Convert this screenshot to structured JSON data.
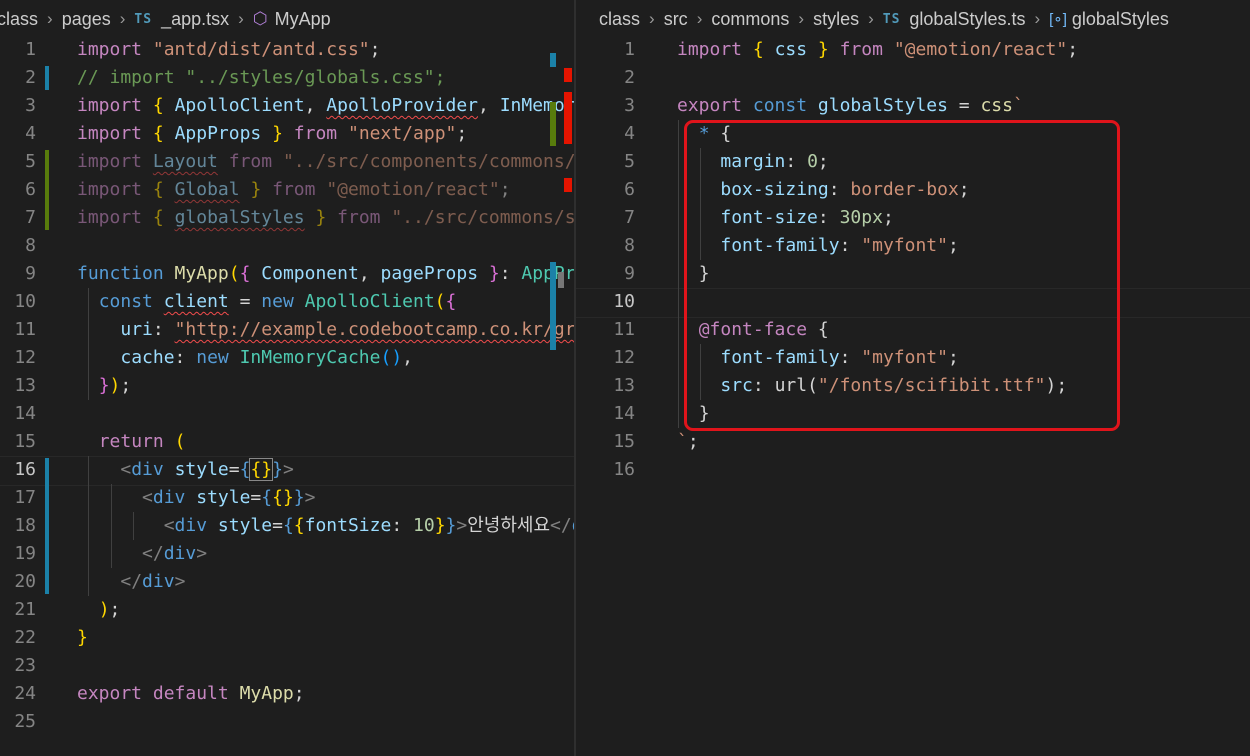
{
  "left": {
    "breadcrumb": [
      "class",
      "pages",
      "_app.tsx",
      "MyApp"
    ],
    "breadcrumb_icons": [
      "typescript-file-icon",
      "symbol-method-icon"
    ],
    "active_line": 16,
    "lines": [
      {
        "n": "1",
        "parts": [
          [
            "import",
            "k"
          ],
          [
            " ",
            "w"
          ],
          [
            "\"antd/dist/antd.css\"",
            "s"
          ],
          [
            ";",
            "w"
          ]
        ]
      },
      {
        "n": "2",
        "parts": [
          [
            "// import \"../styles/globals.css\";",
            "c"
          ]
        ]
      },
      {
        "n": "3",
        "parts": [
          [
            "import",
            "k"
          ],
          [
            " ",
            "w"
          ],
          [
            "{",
            "b1"
          ],
          [
            " ",
            "w"
          ],
          [
            "ApolloClient",
            "v"
          ],
          [
            ", ",
            "w"
          ],
          [
            "ApolloProvider",
            "v sq"
          ],
          [
            ", ",
            "w"
          ],
          [
            "InMemoryCache",
            "v"
          ]
        ]
      },
      {
        "n": "4",
        "parts": [
          [
            "import",
            "k"
          ],
          [
            " ",
            "w"
          ],
          [
            "{",
            "b1"
          ],
          [
            " ",
            "w"
          ],
          [
            "AppProps",
            "v"
          ],
          [
            " ",
            "w"
          ],
          [
            "}",
            "b1"
          ],
          [
            " ",
            "w"
          ],
          [
            "from",
            "k"
          ],
          [
            " ",
            "w"
          ],
          [
            "\"next/app\"",
            "s"
          ],
          [
            ";",
            "w"
          ]
        ]
      },
      {
        "n": "5",
        "parts": [
          [
            "import",
            "k dim"
          ],
          [
            " ",
            "w"
          ],
          [
            "Layout",
            "v sq dim"
          ],
          [
            " ",
            "w"
          ],
          [
            "from",
            "k dim"
          ],
          [
            " ",
            "w"
          ],
          [
            "\"../src/components/commons/layout\"",
            "s dim"
          ]
        ]
      },
      {
        "n": "6",
        "parts": [
          [
            "import",
            "k dim"
          ],
          [
            " ",
            "w"
          ],
          [
            "{",
            "b1 dim"
          ],
          [
            " ",
            "w"
          ],
          [
            "Global",
            "v sq dim"
          ],
          [
            " ",
            "w"
          ],
          [
            "}",
            "b1 dim"
          ],
          [
            " ",
            "w"
          ],
          [
            "from",
            "k dim"
          ],
          [
            " ",
            "w"
          ],
          [
            "\"@emotion/react\"",
            "s dim"
          ],
          [
            ";",
            "w dim"
          ]
        ]
      },
      {
        "n": "7",
        "parts": [
          [
            "import",
            "k dim"
          ],
          [
            " ",
            "w"
          ],
          [
            "{",
            "b1 dim"
          ],
          [
            " ",
            "w"
          ],
          [
            "globalStyles",
            "v sq dim"
          ],
          [
            " ",
            "w"
          ],
          [
            "}",
            "b1 dim"
          ],
          [
            " ",
            "w"
          ],
          [
            "from",
            "k dim"
          ],
          [
            " ",
            "w"
          ],
          [
            "\"../src/commons/styles\"",
            "s dim"
          ]
        ]
      },
      {
        "n": "8",
        "parts": []
      },
      {
        "n": "9",
        "parts": [
          [
            "function",
            "kw"
          ],
          [
            " ",
            "w"
          ],
          [
            "MyApp",
            "f"
          ],
          [
            "(",
            "b1"
          ],
          [
            "{",
            "b2"
          ],
          [
            " ",
            "w"
          ],
          [
            "Component",
            "v"
          ],
          [
            ", ",
            "w"
          ],
          [
            "pageProps",
            "v"
          ],
          [
            " ",
            "w"
          ],
          [
            "}",
            "b2"
          ],
          [
            ": ",
            "w"
          ],
          [
            "AppProps",
            "t"
          ],
          [
            ")",
            "b1"
          ]
        ]
      },
      {
        "n": "10",
        "parts": [
          [
            "  ",
            "w"
          ],
          [
            "const",
            "kw"
          ],
          [
            " ",
            "w"
          ],
          [
            "client",
            "v sq"
          ],
          [
            " = ",
            "w"
          ],
          [
            "new",
            "kw"
          ],
          [
            " ",
            "w"
          ],
          [
            "ApolloClient",
            "t"
          ],
          [
            "(",
            "b1"
          ],
          [
            "{",
            "b2"
          ]
        ]
      },
      {
        "n": "11",
        "parts": [
          [
            "    ",
            "w"
          ],
          [
            "uri",
            "v"
          ],
          [
            ": ",
            "w"
          ],
          [
            "\"http://example.codebootcamp.co.kr/graphql\"",
            "s sq"
          ]
        ]
      },
      {
        "n": "12",
        "parts": [
          [
            "    ",
            "w"
          ],
          [
            "cache",
            "v"
          ],
          [
            ": ",
            "w"
          ],
          [
            "new",
            "kw"
          ],
          [
            " ",
            "w"
          ],
          [
            "InMemoryCache",
            "t"
          ],
          [
            "()",
            "b3"
          ],
          [
            ",",
            "w"
          ]
        ]
      },
      {
        "n": "13",
        "parts": [
          [
            "  ",
            "w"
          ],
          [
            "}",
            "b2"
          ],
          [
            ")",
            "b1"
          ],
          [
            ";",
            "w"
          ]
        ]
      },
      {
        "n": "14",
        "parts": []
      },
      {
        "n": "15",
        "parts": [
          [
            "  ",
            "w"
          ],
          [
            "return",
            "k"
          ],
          [
            " ",
            "w"
          ],
          [
            "(",
            "b1"
          ]
        ]
      },
      {
        "n": "16",
        "parts": [
          [
            "    ",
            "w"
          ],
          [
            "<",
            "tag"
          ],
          [
            "div",
            "kw"
          ],
          [
            " ",
            "w"
          ],
          [
            "style",
            "v"
          ],
          [
            "=",
            "w"
          ],
          [
            "{",
            "kw"
          ],
          [
            "{}",
            "b1 bracket-hl"
          ],
          [
            "}",
            "kw"
          ],
          [
            ">",
            "tag"
          ]
        ]
      },
      {
        "n": "17",
        "parts": [
          [
            "      ",
            "w"
          ],
          [
            "<",
            "tag"
          ],
          [
            "div",
            "kw"
          ],
          [
            " ",
            "w"
          ],
          [
            "style",
            "v"
          ],
          [
            "=",
            "w"
          ],
          [
            "{",
            "kw"
          ],
          [
            "{}",
            "b1"
          ],
          [
            "}",
            "kw"
          ],
          [
            ">",
            "tag"
          ]
        ]
      },
      {
        "n": "18",
        "parts": [
          [
            "        ",
            "w"
          ],
          [
            "<",
            "tag"
          ],
          [
            "div",
            "kw"
          ],
          [
            " ",
            "w"
          ],
          [
            "style",
            "v"
          ],
          [
            "=",
            "w"
          ],
          [
            "{",
            "kw"
          ],
          [
            "{",
            "b1"
          ],
          [
            "fontSize",
            "v"
          ],
          [
            ": ",
            "w"
          ],
          [
            "10",
            "n"
          ],
          [
            "}",
            "b1"
          ],
          [
            "}",
            "kw"
          ],
          [
            ">",
            "tag"
          ],
          [
            "안녕하세요",
            "w"
          ],
          [
            "</",
            "tag"
          ],
          [
            "div",
            "kw"
          ],
          [
            ">",
            "tag"
          ]
        ]
      },
      {
        "n": "19",
        "parts": [
          [
            "      ",
            "w"
          ],
          [
            "</",
            "tag"
          ],
          [
            "div",
            "kw"
          ],
          [
            ">",
            "tag"
          ]
        ]
      },
      {
        "n": "20",
        "parts": [
          [
            "    ",
            "w"
          ],
          [
            "</",
            "tag"
          ],
          [
            "div",
            "kw"
          ],
          [
            ">",
            "tag"
          ]
        ]
      },
      {
        "n": "21",
        "parts": [
          [
            "  ",
            "w"
          ],
          [
            ")",
            "b1"
          ],
          [
            ";",
            "w"
          ]
        ]
      },
      {
        "n": "22",
        "parts": [
          [
            "}",
            "b1"
          ]
        ]
      },
      {
        "n": "23",
        "parts": []
      },
      {
        "n": "24",
        "parts": [
          [
            "export",
            "k"
          ],
          [
            " ",
            "w"
          ],
          [
            "default",
            "k"
          ],
          [
            " ",
            "w"
          ],
          [
            "MyApp",
            "f"
          ],
          [
            ";",
            "w"
          ]
        ]
      },
      {
        "n": "25",
        "parts": []
      }
    ]
  },
  "right": {
    "breadcrumb": [
      "class",
      "src",
      "commons",
      "styles",
      "globalStyles.ts",
      "globalStyles"
    ],
    "breadcrumb_icons": [
      "typescript-file-icon",
      "symbol-variable-icon"
    ],
    "active_line": 10,
    "lines": [
      {
        "n": "1",
        "parts": [
          [
            "import",
            "k"
          ],
          [
            " ",
            "w"
          ],
          [
            "{",
            "b1"
          ],
          [
            " ",
            "w"
          ],
          [
            "css",
            "v"
          ],
          [
            " ",
            "w"
          ],
          [
            "}",
            "b1"
          ],
          [
            " ",
            "w"
          ],
          [
            "from",
            "k"
          ],
          [
            " ",
            "w"
          ],
          [
            "\"@emotion/react\"",
            "s"
          ],
          [
            ";",
            "w"
          ]
        ]
      },
      {
        "n": "2",
        "parts": []
      },
      {
        "n": "3",
        "parts": [
          [
            "export",
            "k"
          ],
          [
            " ",
            "w"
          ],
          [
            "const",
            "kw"
          ],
          [
            " ",
            "w"
          ],
          [
            "globalStyles",
            "v"
          ],
          [
            " = ",
            "w"
          ],
          [
            "css",
            "f"
          ],
          [
            "`",
            "s"
          ]
        ]
      },
      {
        "n": "4",
        "parts": [
          [
            "  ",
            "w"
          ],
          [
            "*",
            "kw"
          ],
          [
            " ",
            "w"
          ],
          [
            "{",
            "w"
          ]
        ]
      },
      {
        "n": "5",
        "parts": [
          [
            "    ",
            "w"
          ],
          [
            "margin",
            "v"
          ],
          [
            ": ",
            "w"
          ],
          [
            "0",
            "n"
          ],
          [
            ";",
            "w"
          ]
        ]
      },
      {
        "n": "6",
        "parts": [
          [
            "    ",
            "w"
          ],
          [
            "box-sizing",
            "v"
          ],
          [
            ": ",
            "w"
          ],
          [
            "border-box",
            "s"
          ],
          [
            ";",
            "w"
          ]
        ]
      },
      {
        "n": "7",
        "parts": [
          [
            "    ",
            "w"
          ],
          [
            "font-size",
            "v"
          ],
          [
            ": ",
            "w"
          ],
          [
            "30px",
            "n"
          ],
          [
            ";",
            "w"
          ]
        ]
      },
      {
        "n": "8",
        "parts": [
          [
            "    ",
            "w"
          ],
          [
            "font-family",
            "v"
          ],
          [
            ": ",
            "w"
          ],
          [
            "\"myfont\"",
            "s"
          ],
          [
            ";",
            "w"
          ]
        ]
      },
      {
        "n": "9",
        "parts": [
          [
            "  ",
            "w"
          ],
          [
            "}",
            "w"
          ]
        ]
      },
      {
        "n": "10",
        "parts": []
      },
      {
        "n": "11",
        "parts": [
          [
            "  ",
            "w"
          ],
          [
            "@font-face",
            "k"
          ],
          [
            " ",
            "w"
          ],
          [
            "{",
            "w"
          ]
        ]
      },
      {
        "n": "12",
        "parts": [
          [
            "    ",
            "w"
          ],
          [
            "font-family",
            "v"
          ],
          [
            ": ",
            "w"
          ],
          [
            "\"myfont\"",
            "s"
          ],
          [
            ";",
            "w"
          ]
        ]
      },
      {
        "n": "13",
        "parts": [
          [
            "    ",
            "w"
          ],
          [
            "src",
            "v"
          ],
          [
            ": ",
            "w"
          ],
          [
            "url(",
            "w"
          ],
          [
            "\"/fonts/scifibit.ttf\"",
            "s"
          ],
          [
            ");",
            "w"
          ]
        ]
      },
      {
        "n": "14",
        "parts": [
          [
            "  ",
            "w"
          ],
          [
            "}",
            "w"
          ]
        ]
      },
      {
        "n": "15",
        "parts": [
          [
            "`",
            "s"
          ],
          [
            ";",
            "w"
          ]
        ]
      },
      {
        "n": "16",
        "parts": []
      }
    ]
  },
  "colors": {
    "background": "#1e1e1e",
    "git_modified": "#1b81a8",
    "git_added": "#587c0c",
    "error_marker": "#e51400",
    "annotation_box": "#e0141b"
  }
}
